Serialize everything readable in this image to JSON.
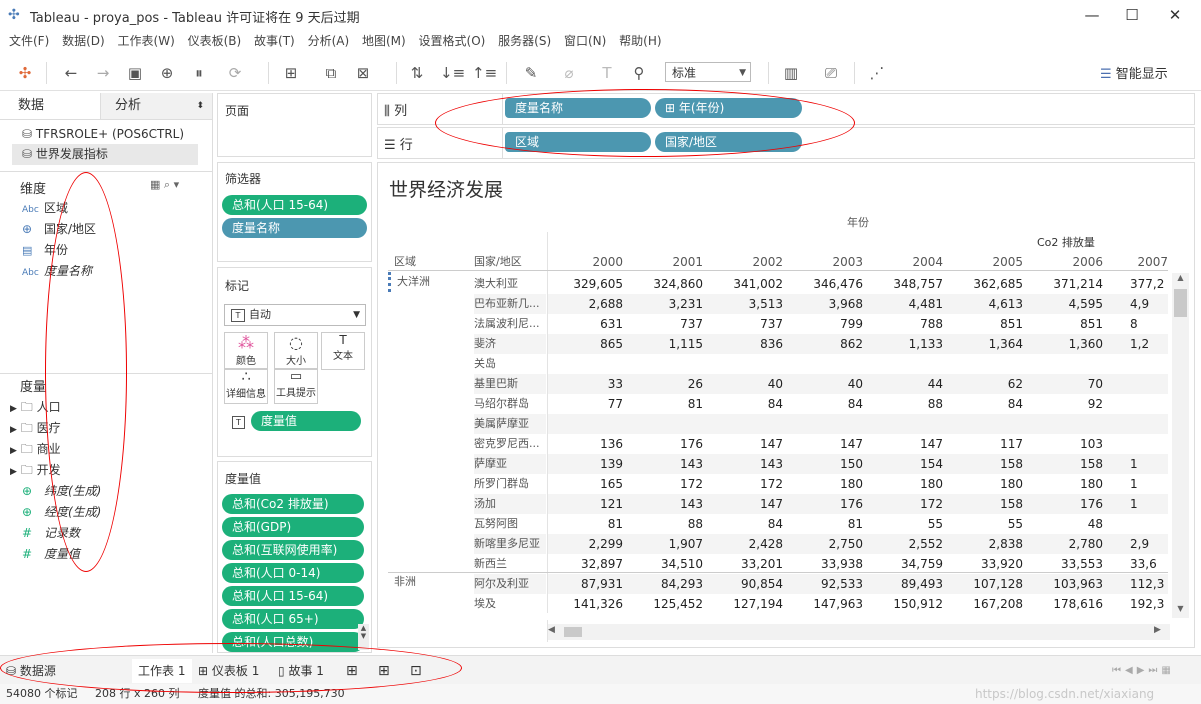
{
  "window": {
    "title": "Tableau - proya_pos - Tableau 许可证将在 9 天后过期"
  },
  "menu": [
    "文件(F)",
    "数据(D)",
    "工作表(W)",
    "仪表板(B)",
    "故事(T)",
    "分析(A)",
    "地图(M)",
    "设置格式(O)",
    "服务器(S)",
    "窗口(N)",
    "帮助(H)"
  ],
  "toolbar": {
    "fit": "标准",
    "show_me": "智能显示"
  },
  "datapane": {
    "tab_data": "数据",
    "tab_analysis": "分析",
    "sources": [
      "TFRSROLE+ (POS6CTRL)",
      "世界发展指标"
    ],
    "dimensions_title": "维度",
    "dimensions": [
      {
        "type": "Abc",
        "name": "区域"
      },
      {
        "type": "globe",
        "name": "国家/地区"
      },
      {
        "type": "cal",
        "name": "年份"
      },
      {
        "type": "Abc",
        "name": "度量名称"
      }
    ],
    "measures_title": "度量",
    "measure_folders": [
      "人口",
      "医疗",
      "商业",
      "开发"
    ],
    "measures": [
      {
        "type": "globe",
        "name": "纬度(生成)"
      },
      {
        "type": "globe",
        "name": "经度(生成)"
      },
      {
        "type": "#",
        "name": "记录数"
      },
      {
        "type": "#",
        "name": "度量值"
      }
    ]
  },
  "shelves": {
    "pages_title": "页面",
    "filters_title": "筛选器",
    "filters": [
      "总和(人口 15-64)",
      "度量名称"
    ],
    "marks_title": "标记",
    "marks_type": "自动",
    "marks_buttons": [
      "颜色",
      "大小",
      "文本",
      "详细信息",
      "工具提示"
    ],
    "marks_pill": "度量值",
    "measure_values_title": "度量值",
    "measure_values": [
      "总和(Co2 排放量)",
      "总和(GDP)",
      "总和(互联网使用率)",
      "总和(人口 0-14)",
      "总和(人口 15-64)",
      "总和(人口 65+)",
      "总和(人口总数)"
    ],
    "columns_label": "列",
    "columns": [
      "度量名称",
      "年(年份)"
    ],
    "rows_label": "行",
    "rows": [
      "区域",
      "国家/地区"
    ]
  },
  "view": {
    "title": "世界经济发展",
    "year_header": "年份",
    "measure_header": "Co2 排放量",
    "col_region": "区域",
    "col_country": "国家/地区",
    "years": [
      "2000",
      "2001",
      "2002",
      "2003",
      "2004",
      "2005",
      "2006",
      "2007"
    ],
    "regions": [
      "大洋洲",
      "非洲"
    ],
    "rows": [
      {
        "country": "澳大利亚",
        "v": [
          "329,605",
          "324,860",
          "341,002",
          "346,476",
          "348,757",
          "362,685",
          "371,214",
          "377,2"
        ]
      },
      {
        "country": "巴布亚新几...",
        "v": [
          "2,688",
          "3,231",
          "3,513",
          "3,968",
          "4,481",
          "4,613",
          "4,595",
          "4,9"
        ]
      },
      {
        "country": "法属波利尼...",
        "v": [
          "631",
          "737",
          "737",
          "799",
          "788",
          "851",
          "851",
          "8"
        ]
      },
      {
        "country": "斐济",
        "v": [
          "865",
          "1,115",
          "836",
          "862",
          "1,133",
          "1,364",
          "1,360",
          "1,2"
        ]
      },
      {
        "country": "关岛",
        "v": [
          "",
          "",
          "",
          "",
          "",
          "",
          "",
          ""
        ]
      },
      {
        "country": "基里巴斯",
        "v": [
          "33",
          "26",
          "40",
          "40",
          "44",
          "62",
          "70",
          ""
        ]
      },
      {
        "country": "马绍尔群岛",
        "v": [
          "77",
          "81",
          "84",
          "84",
          "88",
          "84",
          "92",
          ""
        ]
      },
      {
        "country": "美属萨摩亚",
        "v": [
          "",
          "",
          "",
          "",
          "",
          "",
          "",
          ""
        ]
      },
      {
        "country": "密克罗尼西...",
        "v": [
          "136",
          "176",
          "147",
          "147",
          "147",
          "117",
          "103",
          ""
        ]
      },
      {
        "country": "萨摩亚",
        "v": [
          "139",
          "143",
          "143",
          "150",
          "154",
          "158",
          "158",
          "1"
        ]
      },
      {
        "country": "所罗门群岛",
        "v": [
          "165",
          "172",
          "172",
          "180",
          "180",
          "180",
          "180",
          "1"
        ]
      },
      {
        "country": "汤加",
        "v": [
          "121",
          "143",
          "147",
          "176",
          "172",
          "158",
          "176",
          "1"
        ]
      },
      {
        "country": "瓦努阿图",
        "v": [
          "81",
          "88",
          "84",
          "81",
          "55",
          "55",
          "48",
          ""
        ]
      },
      {
        "country": "新喀里多尼亚",
        "v": [
          "2,299",
          "1,907",
          "2,428",
          "2,750",
          "2,552",
          "2,838",
          "2,780",
          "2,9"
        ]
      },
      {
        "country": "新西兰",
        "v": [
          "32,897",
          "34,510",
          "33,201",
          "33,938",
          "34,759",
          "33,920",
          "33,553",
          "33,6"
        ]
      },
      {
        "country": "阿尔及利亚",
        "v": [
          "87,931",
          "84,293",
          "90,854",
          "92,533",
          "89,493",
          "107,128",
          "103,963",
          "112,3"
        ]
      },
      {
        "country": "埃及",
        "v": [
          "141,326",
          "125,452",
          "127,194",
          "147,963",
          "150,912",
          "167,208",
          "178,616",
          "192,3"
        ]
      }
    ]
  },
  "tabs": {
    "datasource": "数据源",
    "sheet": "工作表 1",
    "dashboard": "仪表板 1",
    "story": "故事 1"
  },
  "status": {
    "marks": "54080 个标记",
    "dims": "208 行 x 260 列",
    "sum": "度量值 的总和: 305,195,730",
    "watermark": "https://blog.csdn.net/xiaxiang"
  },
  "colors": {
    "pill_green": "#1cb07a",
    "pill_blue": "#4c97b0",
    "annotation_red": "#e00000"
  }
}
